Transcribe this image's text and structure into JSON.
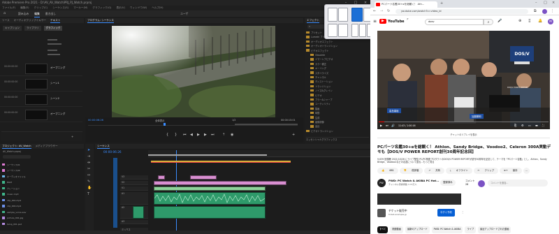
{
  "premiere": {
    "title": "Adobe Premiere Pro 2021 - D:\\AV_AV_Watch\\PRJ_PJ_Watch.prproj",
    "menu": [
      "ファイル(F)",
      "編集(E)",
      "クリップ(C)",
      "シーケンス(S)",
      "マーカー(M)",
      "グラフィック(G)",
      "表示(V)",
      "ウィンドウ(W)",
      "ヘルプ(H)"
    ],
    "workspace_tabs": [
      "読み込み",
      "編集",
      "書き出し"
    ],
    "active_workspace": "編集",
    "project_name": "ユーザ",
    "left_panel_tabs": [
      "ソース",
      "オーディオクリップミキサー",
      "テキスト"
    ],
    "graphics_subtabs": [
      "キャプション",
      "ライブラリ",
      "グラフィック"
    ],
    "caption_rows": [
      {
        "tc": "00:00:00:00",
        "label": "オープニング"
      },
      {
        "tc": "00:00:00:00",
        "label": "シーン1"
      },
      {
        "tc": "00:00:00:00",
        "label": "シーン2"
      },
      {
        "tc": "00:00:00:00",
        "label": "オープニング"
      }
    ],
    "monitor_tab": "プログラム: シーケンス",
    "monitor_tc_left": "00:00:06:26",
    "monitor_fit": "全体表示",
    "monitor_quality": "1/2",
    "monitor_tc_right": "00:00:15:01",
    "effects_tab": "エフェクト",
    "effects_items": [
      "プリセット",
      "Lumetri プリセット",
      "オーディオエフェクト",
      "オーディオトランジション",
      "ビデオエフェクト",
      "Obsolete",
      "イマーシブビデオ",
      "カラー補正",
      "キーイング",
      "スタイライズ",
      "チャンネル",
      "ディストーション",
      "トランジション",
      "ノイズ&グレイン",
      "ビデオ",
      "ブラー&シャープ",
      "ユーティリティ",
      "描画",
      "時間",
      "生成",
      "画像制御",
      "遠近",
      "ビデオトランジション"
    ],
    "effects_footer": [
      "エッセンシャルグラフィックス",
      "エッセンシャルサウンド",
      "Lumetri カラー",
      "ライブラリ",
      "マーカー",
      "ヒストリー"
    ],
    "project_tabs": [
      "プロジェクト: AV_Watch",
      "メディアブラウザー"
    ],
    "project_file": "AV_Watch.prproj",
    "project_items": [
      "シーケンス01",
      "シーケンス02",
      "オーディオファイル",
      "BGM",
      "ナレーション",
      "music.mp3",
      "clip_001.mp4",
      "clip_002.mp4",
      "sample_voice.wav",
      "picture_001.jpg",
      "telop_001.psd"
    ],
    "timeline_tab": "シーケンス",
    "timeline_tc": "00:00:06:26",
    "timeline_tracks": [
      "V3",
      "V2",
      "V1",
      "A1",
      "A2",
      "A3",
      "ミックス"
    ]
  },
  "chrome": {
    "tab_title": "PCパーツ名鑑30+αを総観く！ Ath...",
    "url": "youtube.com/watch?v=video_id",
    "search_query": "dosv",
    "logo": "YouTube",
    "logo_region": "JP",
    "video_overlay_chips": [
      "高島康裕",
      "加藤勝明"
    ],
    "video_overlay_brand": "DOS/V POWER REPORT",
    "video_time": "11:43 / 1:00:16",
    "video_caption": "チャットのリプレイを表示",
    "title": "PCパーツ名鑑30+αを総観く！ Athlon、Sandy Bridge、Voodoo2、Celeron 300A実動デモも【DOS/V POWER REPORT創刊30周年記念回】",
    "meta": "9,639 回視聴 2021/10/26 にライブ配信 PC/PC関連プロダクトのDOS/V POWER REPORTが創刊30周年を記念して、テーマを「PCパーツ名鑑」とし、Athlon、Sandy Bridge、Voodoo2などの名品について語る…もっと見る",
    "actions": [
      "681",
      "低評価",
      "共有",
      "オフライン",
      "クリップ",
      "保存"
    ],
    "channel_name": "PWD: PC Watch & AKIBA PC Hot...",
    "channel_subs": "チャンネル登録者数 3.72万人",
    "subscribe": "登録済み",
    "comments_count": "コメント 28",
    "comment_placeholder": "コメントを追加…",
    "ad_title": "チケット販売中",
    "ad_url": "ticket.example.jp",
    "ad_button": "今すぐ予約",
    "chips": [
      "すべて",
      "関連動画",
      "最新のアップロード",
      "PWD: PC Watch & AKIBA",
      "ライブ",
      "最近アップロードされた動画"
    ]
  }
}
